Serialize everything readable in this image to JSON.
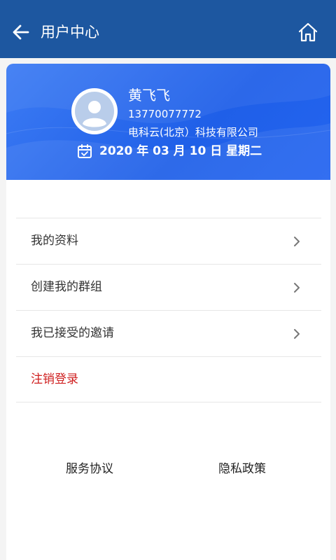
{
  "header": {
    "title": "用户中心",
    "back_icon": "arrow-left-icon",
    "home_icon": "home-icon",
    "background": "#1d57a0"
  },
  "profile": {
    "name": "黄飞飞",
    "phone": "13770077772",
    "company": "电科云(北京）科技有限公司",
    "date": "2020 年 03 月 10 日 星期二",
    "avatar_icon": "user-avatar-icon",
    "calendar_icon": "calendar-icon",
    "card_color": "#2465f0"
  },
  "menu": {
    "items": [
      {
        "label": "我的资料"
      },
      {
        "label": "创建我的群组"
      },
      {
        "label": "我已接受的邀请"
      },
      {
        "label": "注销登录"
      }
    ],
    "chevron_icon": "chevron-right-icon",
    "logout_color": "#cf1f1f"
  },
  "footer": {
    "service_agreement": "服务协议",
    "privacy_policy": "隐私政策"
  }
}
